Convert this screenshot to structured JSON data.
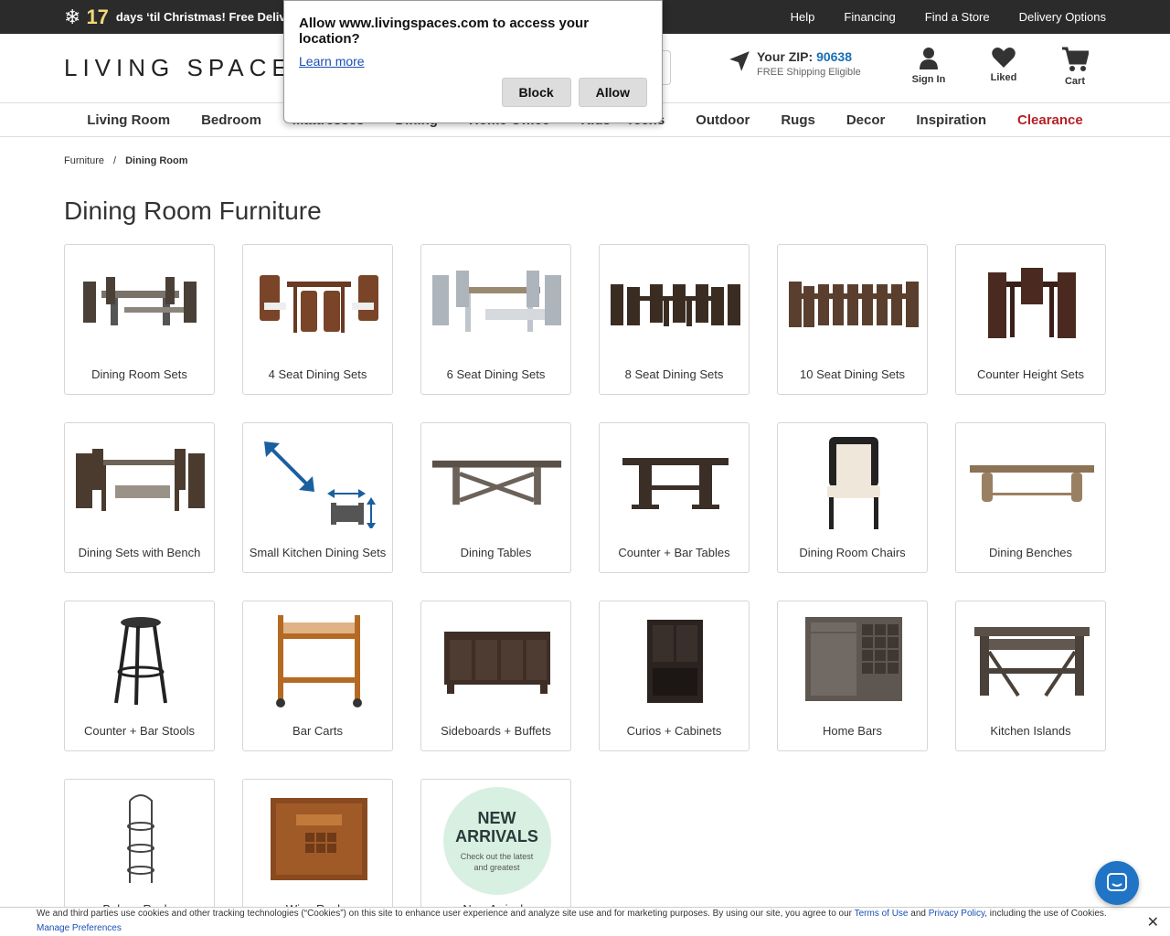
{
  "topbar": {
    "days": "17",
    "promo_text": "days ‘til Christmas! Free Delive",
    "links": [
      "Help",
      "Financing",
      "Find a Store",
      "Delivery Options"
    ]
  },
  "header": {
    "logo": "LIVING SPACES",
    "zip_label": "Your ZIP:",
    "zip_value": "90638",
    "zip_sub": "FREE Shipping Eligible",
    "sign_in": "Sign In",
    "liked": "Liked",
    "cart": "Cart"
  },
  "nav": [
    "Living Room",
    "Bedroom",
    "Mattresses",
    "Dining",
    "Home Office",
    "Kids + Teens",
    "Outdoor",
    "Rugs",
    "Decor",
    "Inspiration",
    "Clearance"
  ],
  "breadcrumb": {
    "root": "Furniture",
    "sep": "/",
    "current": "Dining Room"
  },
  "page_title": "Dining Room Furniture",
  "categories": [
    {
      "label": "Dining Room Sets",
      "icon": "dining-set-icon"
    },
    {
      "label": "4 Seat Dining Sets",
      "icon": "dining-set-icon"
    },
    {
      "label": "6 Seat Dining Sets",
      "icon": "dining-set-icon"
    },
    {
      "label": "8 Seat Dining Sets",
      "icon": "dining-set-icon"
    },
    {
      "label": "10 Seat Dining Sets",
      "icon": "dining-set-icon"
    },
    {
      "label": "Counter Height Sets",
      "icon": "dining-set-icon"
    },
    {
      "label": "Dining Sets with Bench",
      "icon": "dining-set-icon"
    },
    {
      "label": "Small Kitchen Dining Sets",
      "icon": "resize-icon"
    },
    {
      "label": "Dining Tables",
      "icon": "table-icon"
    },
    {
      "label": "Counter + Bar Tables",
      "icon": "table-icon"
    },
    {
      "label": "Dining Room Chairs",
      "icon": "chair-icon"
    },
    {
      "label": "Dining Benches",
      "icon": "bench-icon"
    },
    {
      "label": "Counter + Bar Stools",
      "icon": "stool-icon"
    },
    {
      "label": "Bar Carts",
      "icon": "cart-icon"
    },
    {
      "label": "Sideboards + Buffets",
      "icon": "sideboard-icon"
    },
    {
      "label": "Curios + Cabinets",
      "icon": "cabinet-icon"
    },
    {
      "label": "Home Bars",
      "icon": "bar-icon"
    },
    {
      "label": "Kitchen Islands",
      "icon": "island-icon"
    },
    {
      "label": "Bakers Racks",
      "icon": "rack-icon"
    },
    {
      "label": "Wine Racks",
      "icon": "wine-icon"
    },
    {
      "label": "New Arrivals",
      "icon": "new-arrivals-icon"
    }
  ],
  "new_arrivals_badge": {
    "line1": "NEW",
    "line2": "ARRIVALS",
    "sub": "Check out the latest and greatest"
  },
  "popup": {
    "title": "Allow www.livingspaces.com to access your location?",
    "learn_more": "Learn more",
    "block": "Block",
    "allow": "Allow"
  },
  "cookie": {
    "text": "We and third parties use cookies and other tracking technologies (“Cookies”) on this site to enhance user experience and analyze site use and for marketing purposes. By using our site, you agree to our ",
    "terms": "Terms of Use",
    "and": " and ",
    "privacy": "Privacy Policy",
    "tail": ", including the use of Cookies.",
    "manage": "Manage Preferences",
    "close": "✕"
  },
  "colors": {
    "accent": "#1f74c5",
    "clearance": "#b81f24",
    "zip": "#1a6fb5",
    "topbar": "#2b2b2b"
  }
}
